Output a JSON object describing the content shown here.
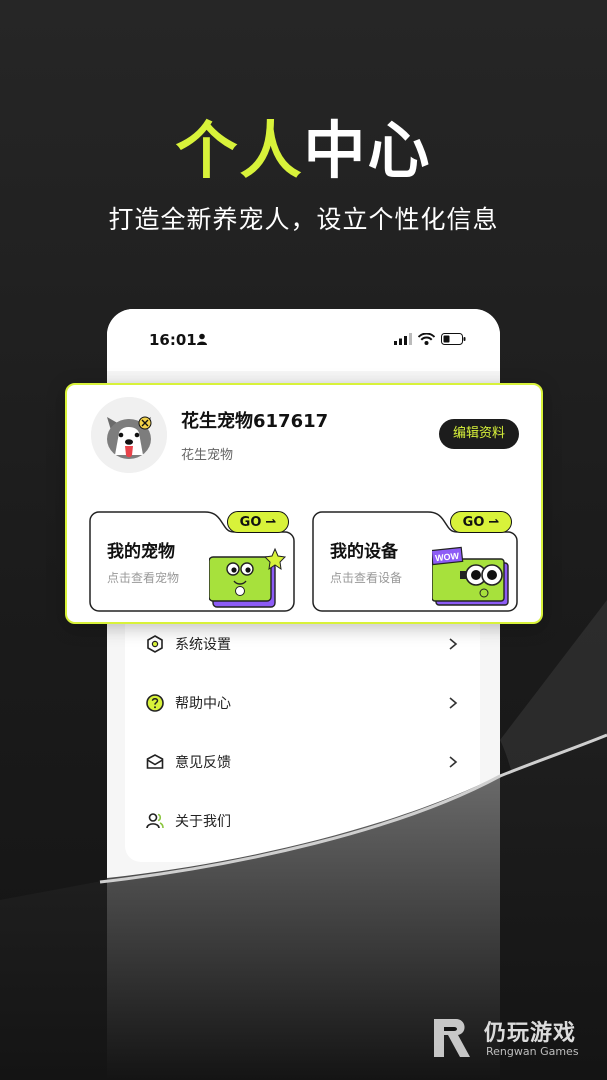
{
  "headline": {
    "part1": "个人",
    "part2": "中心"
  },
  "subtitle": "打造全新养宠人，设立个性化信息",
  "status_bar": {
    "time": "16:01"
  },
  "profile": {
    "name": "花生宠物617617",
    "sub": "花生宠物",
    "edit_label": "编辑资料"
  },
  "features": [
    {
      "title": "我的宠物",
      "sub": "点击查看宠物",
      "go": "GO"
    },
    {
      "title": "我的设备",
      "sub": "点击查看设备",
      "go": "GO"
    }
  ],
  "illustration_text": "WOW",
  "menu": [
    {
      "label": "系统设置",
      "icon": "hexagon-settings-icon"
    },
    {
      "label": "帮助中心",
      "icon": "question-circle-icon"
    },
    {
      "label": "意见反馈",
      "icon": "mail-icon"
    },
    {
      "label": "关于我们",
      "icon": "users-icon"
    }
  ],
  "watermark": {
    "name": "仍玩游戏",
    "sub": "Rengwan Games"
  },
  "colors": {
    "accent": "#d8f23a",
    "dark": "#1c1c1c",
    "illustration_green": "#a7e13c",
    "illustration_purple": "#8d5cf6"
  }
}
